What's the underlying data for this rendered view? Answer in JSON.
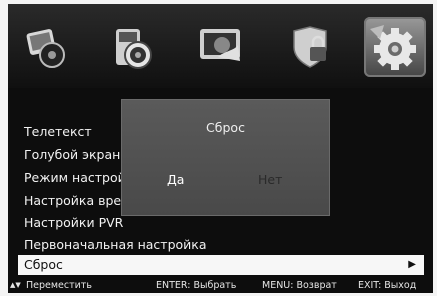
{
  "categories": [
    {
      "id": "picture",
      "icon": "picture-icon"
    },
    {
      "id": "sound",
      "icon": "speaker-icon"
    },
    {
      "id": "channel",
      "icon": "tv-channel-icon"
    },
    {
      "id": "lock",
      "icon": "lock-icon"
    },
    {
      "id": "setup",
      "icon": "gear-icon",
      "selected": true
    }
  ],
  "menu": {
    "items": [
      {
        "label": "Телетекст"
      },
      {
        "label": "Голубой экран"
      },
      {
        "label": "Режим настройки"
      },
      {
        "label": "Настройка времени"
      },
      {
        "label": "Настройки PVR"
      },
      {
        "label": "Первоначальная настройка"
      },
      {
        "label": "Сброс",
        "selected": true,
        "arrow": "▶"
      }
    ]
  },
  "dialog": {
    "title": "Сброс",
    "yes": "Да",
    "no": "Нет"
  },
  "footer": {
    "move_icon": "▲▼",
    "move": "Переместить",
    "enter": "ENTER: Выбрать",
    "menu": "MENU: Возврат",
    "exit": "EXIT: Выход"
  }
}
